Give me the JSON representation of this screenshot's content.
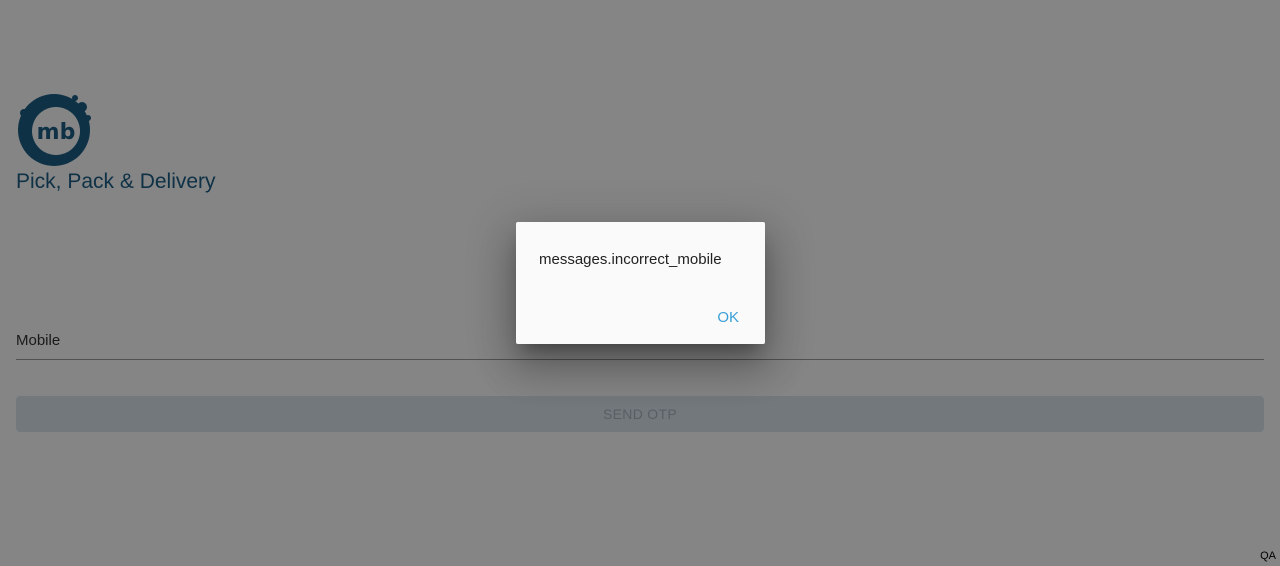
{
  "app": {
    "title": "Pick, Pack & Delivery",
    "logo_text": "mb"
  },
  "form": {
    "mobile_label": "Mobile",
    "mobile_value": "",
    "send_otp_label": "SEND OTP"
  },
  "dialog": {
    "message": "messages.incorrect_mobile",
    "ok_label": "OK"
  },
  "environment_badge": "QA",
  "colors": {
    "brand": "#1b5e86",
    "button_disabled_bg": "#dde7f0",
    "dialog_action": "#3aa0d8",
    "overlay": "rgba(0,0,0,0.48)"
  }
}
